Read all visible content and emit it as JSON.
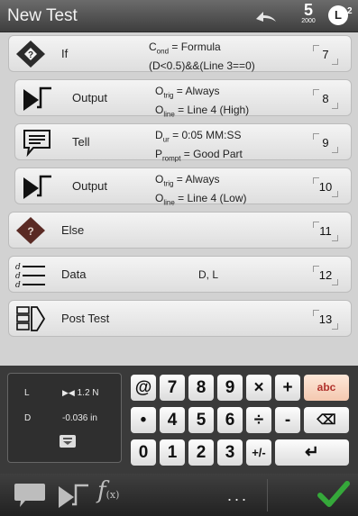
{
  "header": {
    "title": "New Test",
    "counter_value": "5",
    "counter_sub": "2000",
    "badge_letter": "L",
    "badge_sup": "2"
  },
  "steps": [
    {
      "name": "If",
      "param1_main": "C",
      "param1_sub": "ond",
      "param1_rest": " = Formula",
      "param2": "(D<0.5)&&(Line 3==0)",
      "num": "7",
      "icon": "if-diamond-icon"
    },
    {
      "name": "Output",
      "param1_main": "O",
      "param1_sub": "trig",
      "param1_rest": " = Always",
      "param2_main": "O",
      "param2_sub": "line",
      "param2_rest": " = Line 4 (High)",
      "num": "8",
      "icon": "output-step-icon"
    },
    {
      "name": "Tell",
      "param1_main": "D",
      "param1_sub": "ur",
      "param1_rest": " = 0:05 MM:SS",
      "param2_main": "P",
      "param2_sub": "rompt",
      "param2_rest": " = Good Part",
      "num": "9",
      "icon": "tell-speech-icon"
    },
    {
      "name": "Output",
      "param1_main": "O",
      "param1_sub": "trig",
      "param1_rest": " = Always",
      "param2_main": "O",
      "param2_sub": "line",
      "param2_rest": " = Line 4 (Low)",
      "num": "10",
      "icon": "output-step-icon"
    },
    {
      "name": "Else",
      "num": "11",
      "icon": "else-diamond-icon"
    },
    {
      "name": "Data",
      "param": "D, L",
      "num": "12",
      "icon": "data-lines-icon"
    },
    {
      "name": "Post Test",
      "num": "13",
      "icon": "post-test-icon"
    }
  ],
  "readout": {
    "l_label": "L",
    "l_value": "1.2 N",
    "d_label": "D",
    "d_value": "-0.036 in"
  },
  "keypad": {
    "row1": [
      "@",
      "7",
      "8",
      "9",
      "×",
      "+",
      "abc"
    ],
    "row2": [
      "•",
      "4",
      "5",
      "6",
      "÷",
      "-",
      "⌫"
    ],
    "row3": [
      "0",
      "1",
      "2",
      "3",
      "+/-",
      "↵"
    ]
  },
  "bottom": {
    "fx_label": "f",
    "fx_sub": "(x)",
    "more": "..."
  },
  "colors": {
    "accent_green": "#35a83a",
    "diamond_dark": "#2b2b2b",
    "diamond_else": "#5a2a24"
  }
}
